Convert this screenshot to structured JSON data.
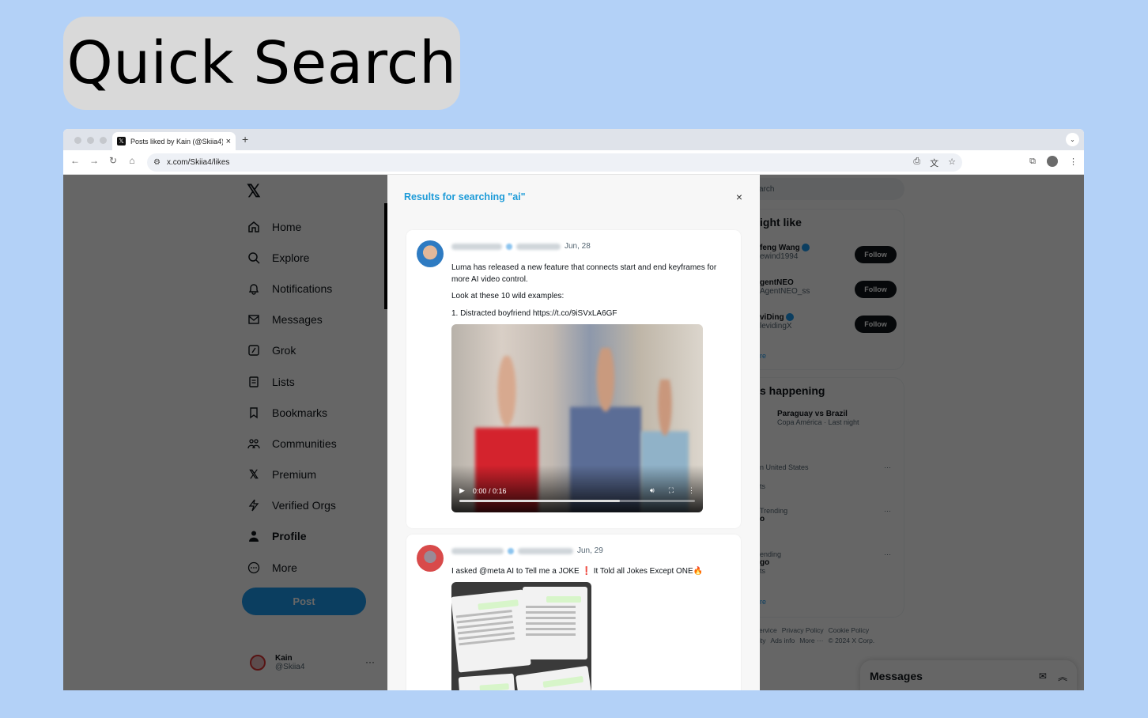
{
  "banner": {
    "title": "Quick Search"
  },
  "browser": {
    "tab_title": "Posts liked by Kain (@Skiia4)",
    "tab_favicon": "x-logo",
    "new_tab": "+",
    "url": "x.com/Skiia4/likes",
    "nav_icons": [
      "back-arrow",
      "forward-arrow",
      "reload",
      "home"
    ],
    "toolbar_icons": [
      "install-app",
      "translate",
      "bookmark-star",
      "extensions",
      "profile-avatar",
      "kebab-menu"
    ]
  },
  "sidebar": {
    "logo": "𝕏",
    "items": [
      {
        "label": "Home",
        "icon": "home-icon"
      },
      {
        "label": "Explore",
        "icon": "search-icon"
      },
      {
        "label": "Notifications",
        "icon": "bell-icon"
      },
      {
        "label": "Messages",
        "icon": "envelope-icon"
      },
      {
        "label": "Grok",
        "icon": "grok-icon"
      },
      {
        "label": "Lists",
        "icon": "list-icon"
      },
      {
        "label": "Bookmarks",
        "icon": "bookmark-icon"
      },
      {
        "label": "Communities",
        "icon": "people-icon"
      },
      {
        "label": "Premium",
        "icon": "x-icon"
      },
      {
        "label": "Verified Orgs",
        "icon": "lightning-icon"
      },
      {
        "label": "Profile",
        "icon": "person-icon"
      },
      {
        "label": "More",
        "icon": "more-circle-icon"
      }
    ],
    "post_button": "Post",
    "user": {
      "name": "Kain",
      "handle": "@Skiia4",
      "more": "···"
    }
  },
  "right": {
    "search_placeholder": "arch",
    "wtf": {
      "title": "ight like",
      "people": [
        {
          "name": "feng Wang",
          "handle": "ewind1994",
          "verified": true,
          "button": "Follow"
        },
        {
          "name": "gentNEO",
          "handle": "AgentNEO_ss",
          "verified": false,
          "button": "Follow"
        },
        {
          "name": "viDing",
          "handle": "levidingX",
          "verified": true,
          "button": "Follow"
        }
      ],
      "show_more": "re"
    },
    "happening": {
      "title": "s happening",
      "featured": {
        "title": "Paraguay vs Brazil",
        "meta": "Copa América · Last night"
      },
      "trends": [
        {
          "context": "n United States",
          "title": "",
          "count": "ts"
        },
        {
          "context": "Trending",
          "title": "o",
          "count": ""
        },
        {
          "context": "ending",
          "title": "go",
          "count": "ts"
        }
      ],
      "show_more": "re"
    },
    "footer": [
      "ervice",
      "Privacy Policy",
      "Cookie Policy",
      "ity",
      "Ads info",
      "More ···",
      "© 2024 X Corp."
    ]
  },
  "messages_dock": {
    "title": "Messages"
  },
  "modal": {
    "title": "Results for searching \"ai\"",
    "close": "×",
    "posts": [
      {
        "date": "Jun, 28",
        "text": [
          "Luma has released a new feature that connects start and end keyframes for more AI video control.",
          "Look at these 10 wild examples:",
          "1. Distracted boyfriend https://t.co/9iSVxLA6GF"
        ],
        "video": {
          "time": "0:00 / 0:16",
          "progress_percent": 68
        }
      },
      {
        "date": "Jun, 29",
        "text": [
          "I asked @meta AI to Tell me a JOKE ❗ It Told all Jokes Except ONE🔥"
        ]
      }
    ]
  }
}
